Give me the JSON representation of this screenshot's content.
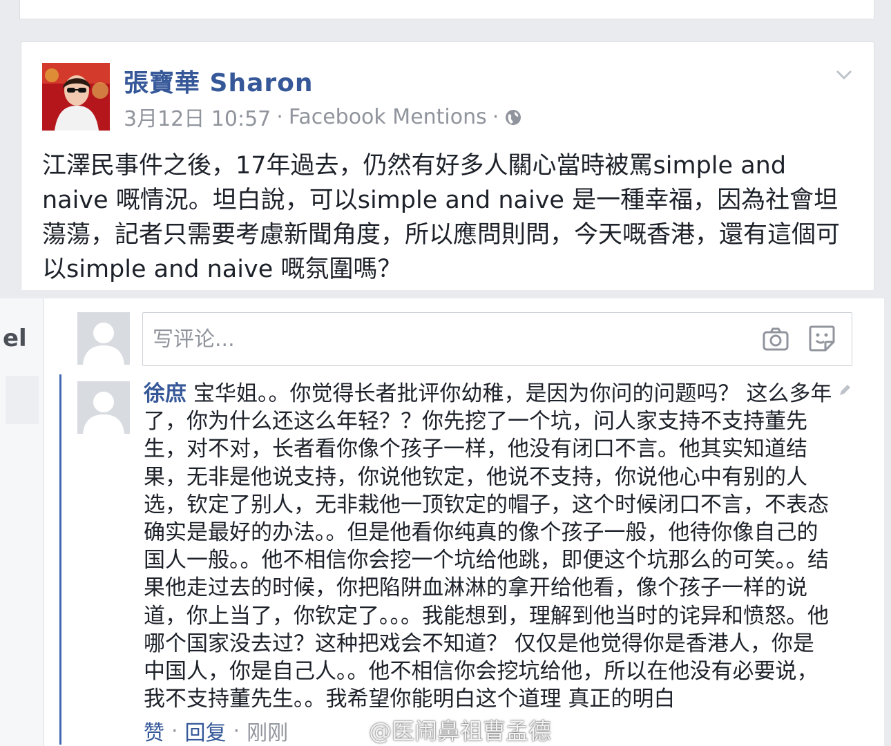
{
  "post": {
    "author": "張寶華 Sharon",
    "date": "3月12日 10:57",
    "separator": "·",
    "source": "Facebook Mentions",
    "privacy_icon": "globe-icon",
    "body": "江澤民事件之後，17年過去，仍然有好多人關心當時被罵simple and naive 嘅情況。坦白說，可以simple and naive 是一種幸福，因為社會坦蕩蕩，記者只需要考慮新聞角度，所以應問則問，今天嘅香港，還有這個可以simple and naive 嘅氛圍嗎？"
  },
  "composer": {
    "placeholder": "写评论..."
  },
  "sidebar": {
    "partial_label": "el"
  },
  "comment": {
    "author": "徐庶",
    "text": "宝华姐。。你觉得长者批评你幼稚，是因为你问的问题吗？ 这么多年了，你为什么还这么年轻？？你先挖了一个坑，问人家支持不支持董先生，对不对，长者看你像个孩子一样，他没有闭口不言。他其实知道结果，无非是他说支持，你说他钦定，他说不支持，你说他心中有别的人选，钦定了别人，无非栽他一顶钦定的帽子，这个时候闭口不言，不表态确实是最好的办法。。但是他看你纯真的像个孩子一般，他待你像自己的国人一般。。他不相信你会挖一个坑给他跳，即便这个坑那么的可笑。。结果他走过去的时候，你把陷阱血淋淋的拿开给他看，像个孩子一样的说道，你上当了，你钦定了。。。我能想到，理解到他当时的诧异和愤怒。他哪个国家没去过？这种把戏会不知道？ 仅仅是他觉得你是香港人，你是中国人，你是自己人。。他不相信你会挖坑给他，所以在他没有必要说，我不支持董先生。。我希望你能明白这个道理 真正的明白",
    "actions": {
      "like": "赞",
      "reply": "回复",
      "separator": "·",
      "time": "刚刚"
    }
  },
  "watermark": {
    "text": "@医闹鼻祖曹孟德"
  },
  "colors": {
    "link": "#365899",
    "accent": "#4267b2",
    "meta": "#90949c",
    "background": "#e9ebee"
  }
}
